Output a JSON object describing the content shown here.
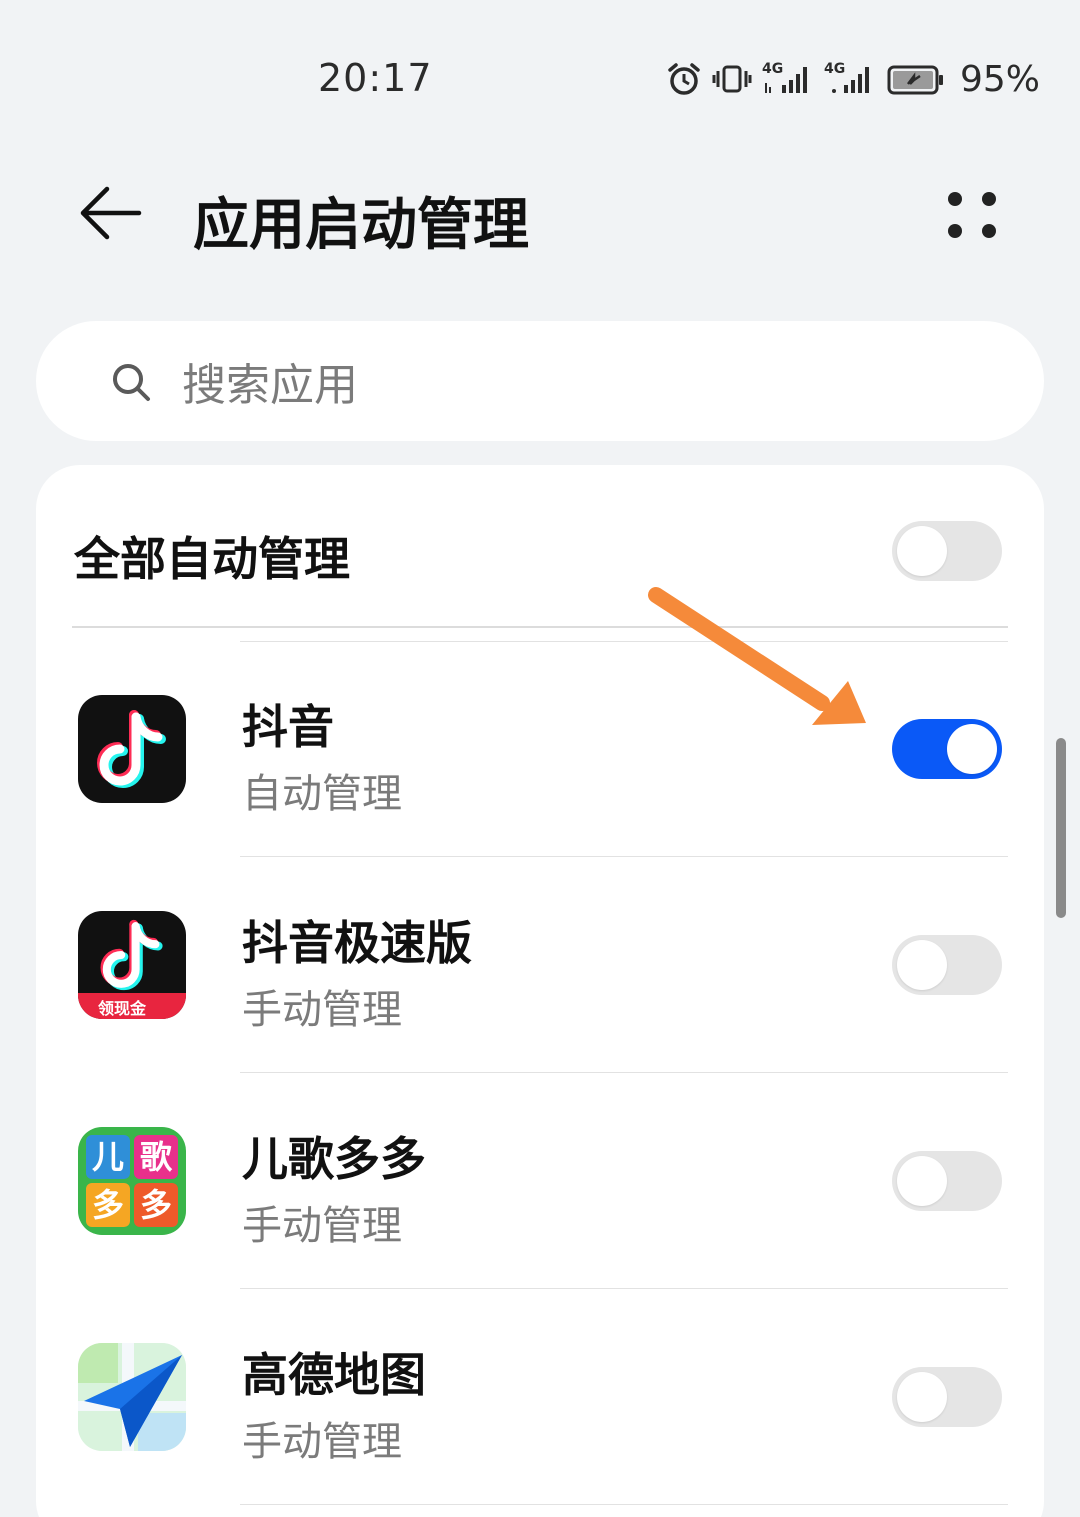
{
  "status_bar": {
    "time": "20:17",
    "network_1": "4G",
    "network_2": "4G",
    "battery": "95%",
    "icons": [
      "alarm-icon",
      "vibrate-icon",
      "signal-icon",
      "signal-icon",
      "battery-icon"
    ]
  },
  "header": {
    "title": "应用启动管理",
    "back_icon": "back-arrow-icon",
    "more_icon": "more-icon"
  },
  "search": {
    "placeholder": "搜索应用"
  },
  "all_manage": {
    "label": "全部自动管理",
    "enabled": false
  },
  "apps": [
    {
      "name": "抖音",
      "mode": "自动管理",
      "enabled": true,
      "icon": "douyin-icon"
    },
    {
      "name": "抖音极速版",
      "mode": "手动管理",
      "enabled": false,
      "icon": "douyin-lite-icon",
      "icon_badge": "领现金"
    },
    {
      "name": "儿歌多多",
      "mode": "手动管理",
      "enabled": false,
      "icon": "ergeduoduo-icon",
      "icon_text": [
        "儿",
        "歌",
        "多",
        "多"
      ]
    },
    {
      "name": "高德地图",
      "mode": "手动管理",
      "enabled": false,
      "icon": "amap-icon"
    }
  ],
  "colors": {
    "accent": "#0a59f7",
    "annotation_arrow": "#f58a3a",
    "background": "#f1f3f5"
  }
}
